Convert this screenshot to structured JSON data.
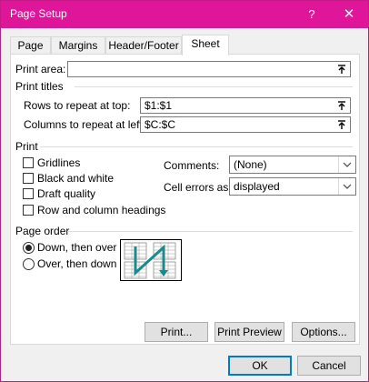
{
  "window": {
    "title": "Page Setup",
    "help": "?",
    "close": "✕"
  },
  "tabs": [
    {
      "label": "Page"
    },
    {
      "label": "Margins"
    },
    {
      "label": "Header/Footer"
    },
    {
      "label": "Sheet"
    }
  ],
  "print_area": {
    "label": "Print area:",
    "value": ""
  },
  "print_titles": {
    "heading": "Print titles",
    "rows_label": "Rows to repeat at top:",
    "rows_value": "$1:$1",
    "cols_label": "Columns to repeat at left:",
    "cols_value": "$C:$C"
  },
  "print": {
    "heading": "Print",
    "gridlines": "Gridlines",
    "black_white": "Black and white",
    "draft": "Draft quality",
    "headings": "Row and column headings",
    "comments_label": "Comments:",
    "comments_value": "(None)",
    "errors_label": "Cell errors as:",
    "errors_value": "displayed"
  },
  "page_order": {
    "heading": "Page order",
    "down_over": "Down, then over",
    "over_down": "Over, then down"
  },
  "buttons": {
    "print": "Print...",
    "print_preview": "Print Preview",
    "options": "Options...",
    "ok": "OK",
    "cancel": "Cancel"
  },
  "colors": {
    "titlebar": "#e0169a",
    "accent": "#0078d7",
    "arrow": "#1a8a8a"
  }
}
